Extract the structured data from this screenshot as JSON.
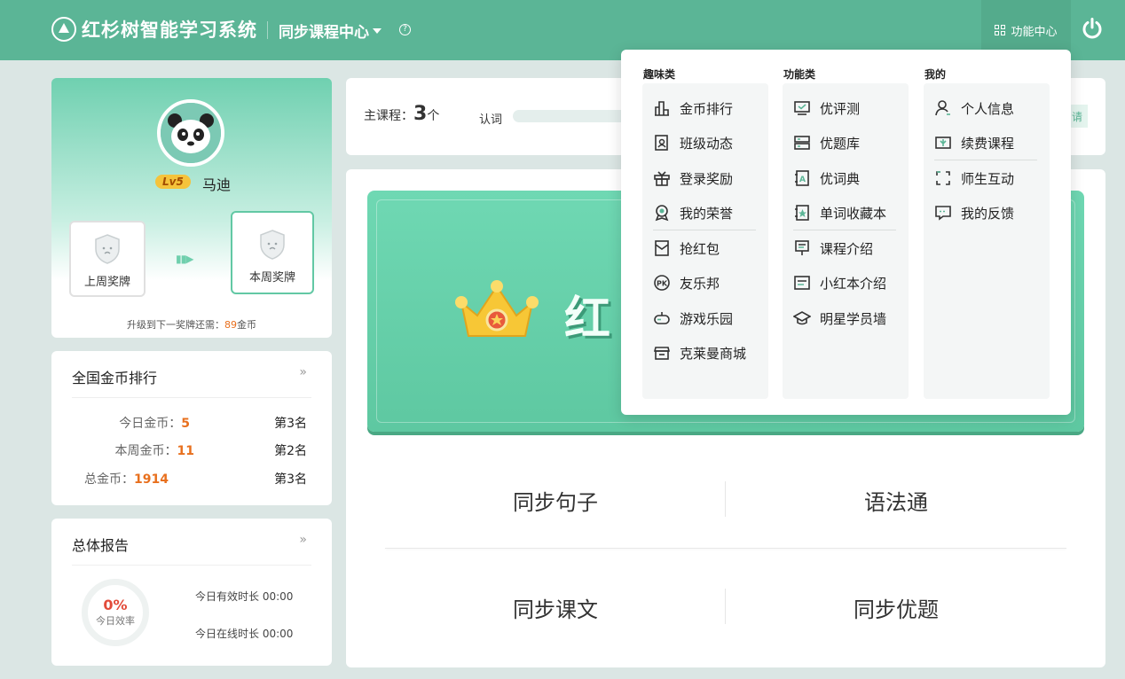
{
  "header": {
    "brand": "红杉树智能学习系统",
    "course_center": "同步课程中心",
    "help_symbol": "?",
    "func_center": "功能中心"
  },
  "profile": {
    "level": "Lv5",
    "name": "马迪",
    "last_week_medal": "上周奖牌",
    "this_week_medal": "本周奖牌",
    "upgrade_prefix": "升级到下一奖牌还需：",
    "upgrade_coins": "89",
    "upgrade_suffix": "金币"
  },
  "rank": {
    "title": "全国金币排行",
    "more": "»",
    "rows": [
      {
        "label": "今日金币：",
        "value": "5",
        "position": "第3名"
      },
      {
        "label": "本周金币：",
        "value": "11",
        "position": "第2名"
      },
      {
        "label": "总金币：",
        "value": "1914",
        "position": "第3名"
      }
    ]
  },
  "report": {
    "title": "总体报告",
    "more": "»",
    "efficiency_value": "0%",
    "efficiency_label": "今日效率",
    "valid_time": "今日有效时长 00:00",
    "online_time": "今日在线时长 00:00"
  },
  "stats": {
    "main_course_label": "主课程：",
    "main_course_count": "3",
    "main_course_unit": "个",
    "word_label": "认词",
    "peek_text": "请"
  },
  "banner": {
    "text": "红"
  },
  "modules": [
    "同步句子",
    "语法通",
    "同步课文",
    "同步优题"
  ],
  "dropdown": {
    "fun": {
      "title": "趣味类",
      "items": [
        "金币排行",
        "班级动态",
        "登录奖励",
        "我的荣誉",
        "抢红包",
        "友乐邦",
        "游戏乐园",
        "克莱曼商城"
      ]
    },
    "func": {
      "title": "功能类",
      "items": [
        "优评测",
        "优题库",
        "优词典",
        "单词收藏本",
        "课程介绍",
        "小红本介绍",
        "明星学员墙"
      ]
    },
    "mine": {
      "title": "我的",
      "items": [
        "个人信息",
        "续费课程",
        "师生互动",
        "我的反馈"
      ]
    }
  },
  "colors": {
    "brand_green": "#5bb596",
    "accent_orange": "#e8701e",
    "efficiency_red": "#e24b3a"
  }
}
